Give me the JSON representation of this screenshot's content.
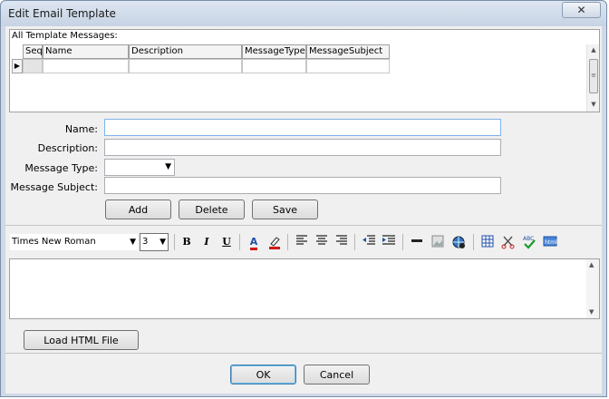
{
  "window": {
    "title": "Edit Email Template",
    "close_glyph": "✕"
  },
  "grid": {
    "caption": "All Template Messages:",
    "columns": [
      "Seq",
      "Name",
      "Description",
      "MessageType",
      "MessageSubject"
    ],
    "row_indicator": "▶",
    "scroll_up": "▲",
    "scroll_down": "▼",
    "thumb_grip": "≡"
  },
  "form": {
    "name_label": "Name:",
    "name_value": "",
    "description_label": "Description:",
    "description_value": "",
    "message_type_label": "Message Type:",
    "message_type_value": "",
    "message_subject_label": "Message Subject:",
    "message_subject_value": ""
  },
  "actions": {
    "add": "Add",
    "delete": "Delete",
    "save": "Save"
  },
  "editor_toolbar": {
    "font_name": "Times New Roman",
    "font_size": "3",
    "bold": "B",
    "italic": "I",
    "underline": "U",
    "font_color_label": "A"
  },
  "editor": {
    "content": ""
  },
  "footer": {
    "load_html": "Load HTML File",
    "ok": "OK",
    "cancel": "Cancel"
  },
  "colors": {
    "accent_blue": "#1f4fa8",
    "font_color_red": "#d01818"
  }
}
